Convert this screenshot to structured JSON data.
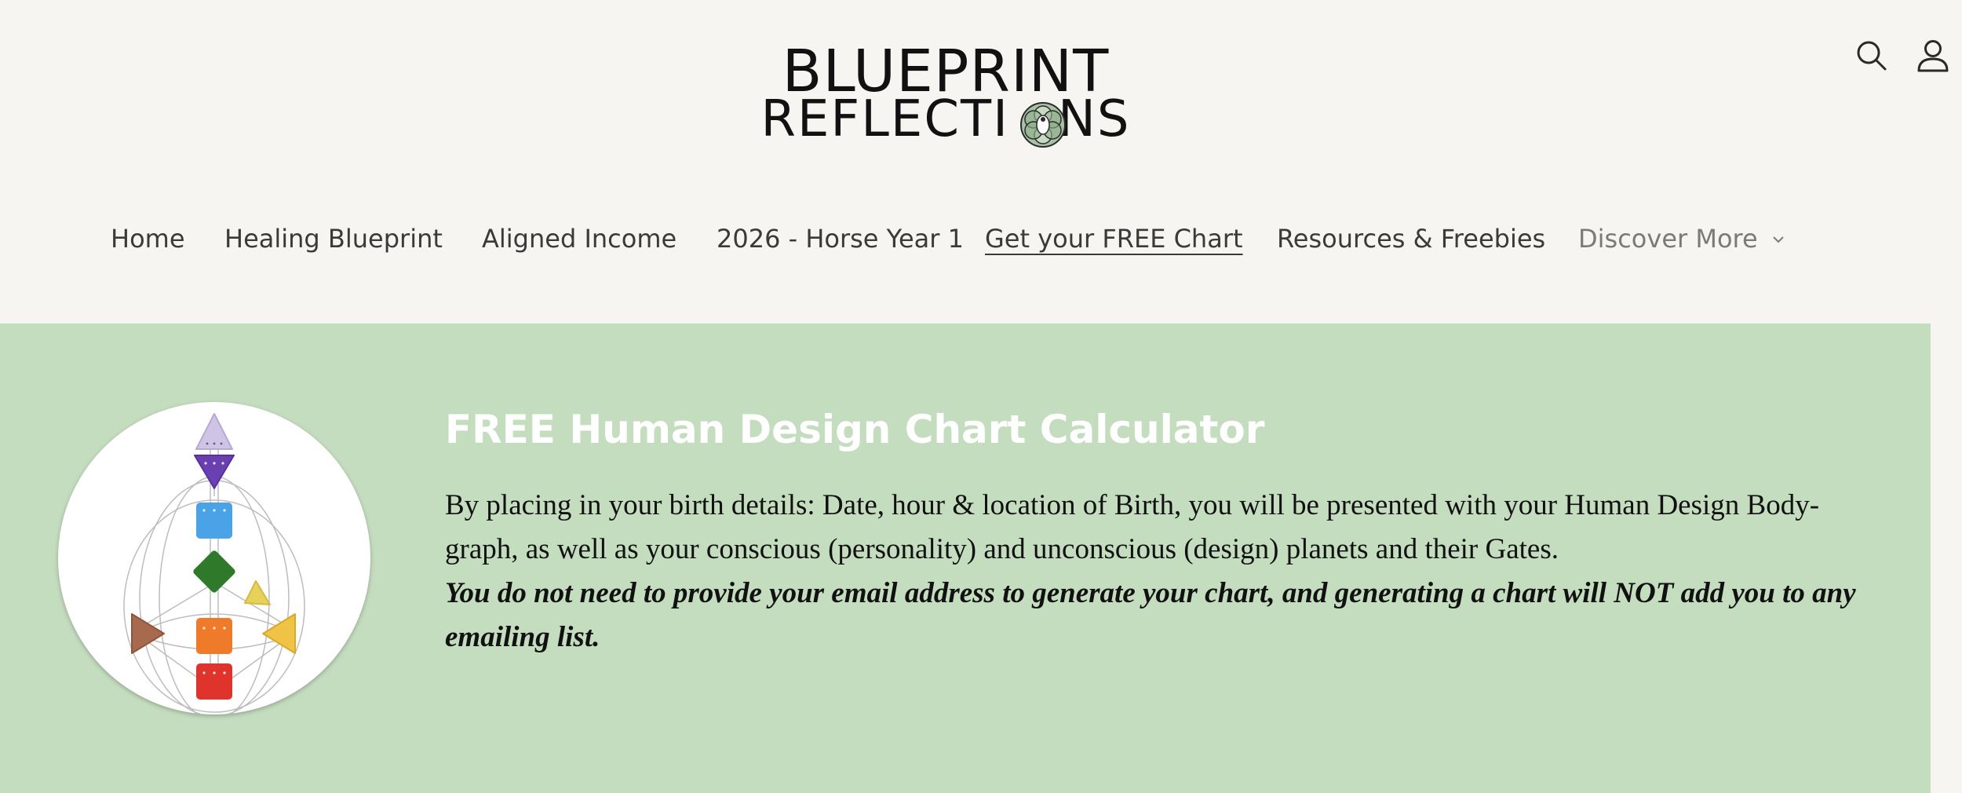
{
  "brand": {
    "logo_line1": "BLUEPRINT",
    "logo_line2_prefix": "REFLECTI",
    "logo_line2_suffix": "NS"
  },
  "header": {
    "search_icon": "search-icon",
    "account_icon": "account-icon"
  },
  "nav": {
    "items": [
      {
        "label": "Home"
      },
      {
        "label": "Healing Blueprint"
      },
      {
        "label": "Aligned Income"
      },
      {
        "label": "2026 - Horse Year 1"
      },
      {
        "label": "Get your FREE Chart",
        "active": true
      },
      {
        "label": "Resources & Freebies"
      },
      {
        "label": "Discover More",
        "has_dropdown": true
      }
    ]
  },
  "banner": {
    "background_color": "#c5ddbf",
    "title": "FREE Human Design Chart Calculator",
    "description": "By placing in your birth details: Date, hour & location of Birth, you will be presented with your Human Design Body-graph, as well as your conscious (personality) and unconscious (design) planets and their Gates.",
    "notice": "You do not need to provide your email address to generate your chart, and generating a chart will NOT add you to any emailing list.",
    "image": "human-design-bodygraph"
  },
  "colors": {
    "page_bg": "#f6f5f1",
    "banner_bg": "#c5ddbf",
    "title_color": "#ffffff",
    "head_center": "#cfc4e6",
    "ajna_center": "#6a3fb0",
    "throat_center": "#4aa3e6",
    "g_center": "#2f7a2a",
    "heart_center": "#e8d15a",
    "spleen_center": "#a86a4f",
    "sacral_center": "#ee7a2a",
    "solar_plexus_center": "#f0c245",
    "root_center": "#e0332c"
  }
}
